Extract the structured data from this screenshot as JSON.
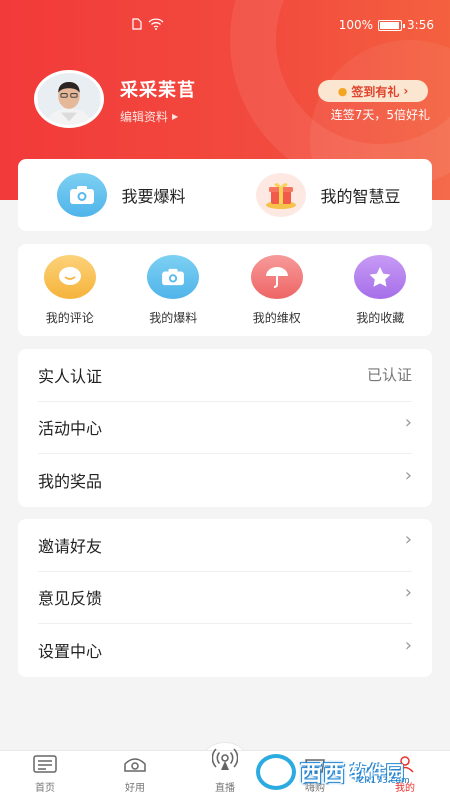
{
  "status_bar": {
    "battery": "100%",
    "time": "3:56"
  },
  "profile": {
    "name": "采采苿苢",
    "edit_label": "编辑资料",
    "signin_label": "签到有礼",
    "signin_sub": "连签7天，5倍好礼"
  },
  "quick_actions": [
    {
      "label": "我要爆料",
      "icon": "camera-icon"
    },
    {
      "label": "我的智慧豆",
      "icon": "gift-icon"
    }
  ],
  "grid": [
    {
      "label": "我的评论",
      "icon": "comment-icon"
    },
    {
      "label": "我的爆料",
      "icon": "camera-icon"
    },
    {
      "label": "我的维权",
      "icon": "umbrella-icon"
    },
    {
      "label": "我的收藏",
      "icon": "star-icon"
    }
  ],
  "list1": [
    {
      "label": "实人认证",
      "value": "已认证"
    },
    {
      "label": "活动中心"
    },
    {
      "label": "我的奖品"
    }
  ],
  "list2": [
    {
      "label": "邀请好友"
    },
    {
      "label": "意见反馈"
    },
    {
      "label": "设置中心"
    }
  ],
  "tabbar": [
    {
      "label": "首页",
      "icon": "home-icon"
    },
    {
      "label": "好用",
      "icon": "eye-icon"
    },
    {
      "label": "直播",
      "icon": "live-icon"
    },
    {
      "label": "嗨购",
      "icon": "shop-icon"
    },
    {
      "label": "我的",
      "icon": "user-icon"
    }
  ],
  "watermark": {
    "brand": "西西",
    "brand2": "软件园",
    "domain": "CR173.com"
  },
  "colors": {
    "brand_red": "#f23a3a",
    "active_tab": "#e8322e"
  }
}
